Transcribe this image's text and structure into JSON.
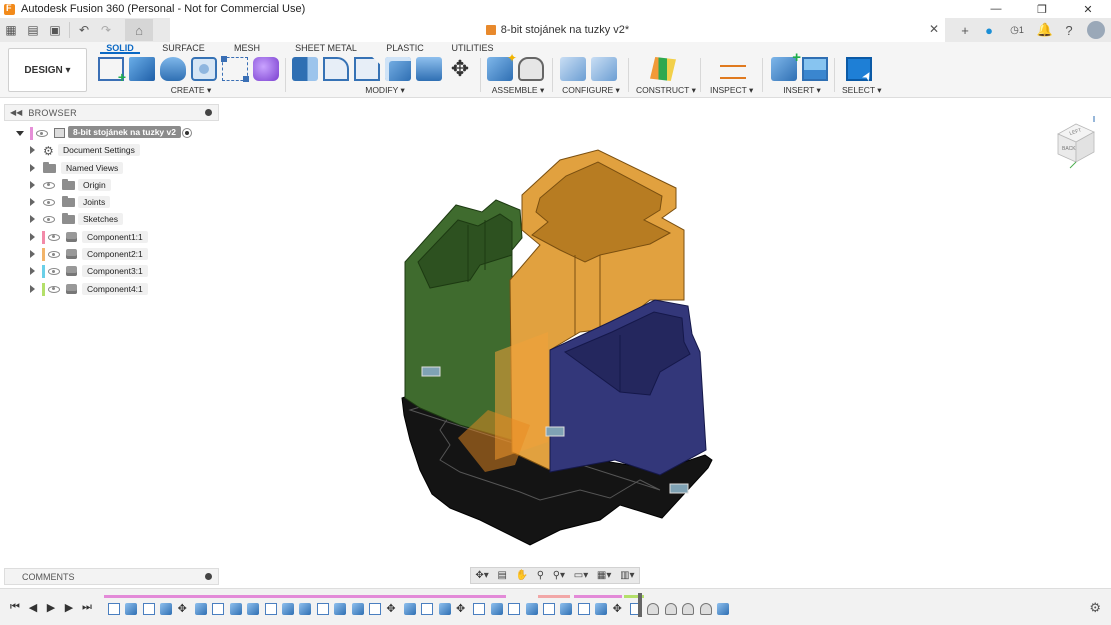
{
  "window": {
    "title": "Autodesk Fusion 360 (Personal - Not for Commercial Use)",
    "controls": [
      "—",
      "❐",
      "✕"
    ]
  },
  "qat": {
    "doc_tab_name": "8-bit stojánek na tuzky v2*",
    "close_glyph": "✕",
    "job_status_count": "1"
  },
  "ribbon": {
    "workspace": "DESIGN ▾",
    "tabs": [
      "SOLID",
      "SURFACE",
      "MESH",
      "SHEET METAL",
      "PLASTIC",
      "UTILITIES"
    ],
    "groups": {
      "create": "CREATE ▾",
      "modify": "MODIFY ▾",
      "assemble": "ASSEMBLE ▾",
      "configure": "CONFIGURE ▾",
      "construct": "CONSTRUCT ▾",
      "inspect": "INSPECT ▾",
      "insert": "INSERT ▾",
      "select": "SELECT ▾"
    }
  },
  "browser": {
    "title": "BROWSER",
    "root": "8-bit stojánek na tuzky v2",
    "items": [
      {
        "label": "Document Settings"
      },
      {
        "label": "Named Views"
      },
      {
        "label": "Origin"
      },
      {
        "label": "Joints"
      },
      {
        "label": "Sketches"
      },
      {
        "label": "Component1:1",
        "color": "#f28aa8"
      },
      {
        "label": "Component2:1",
        "color": "#f2b46a"
      },
      {
        "label": "Component3:1",
        "color": "#6ad0e8"
      },
      {
        "label": "Component4:1",
        "color": "#b4e06a"
      }
    ]
  },
  "comments": {
    "title": "COMMENTS"
  },
  "viewcube": {
    "top_face": "LEFT",
    "side_face": "BACK"
  },
  "colors": {
    "accent": "#0a68c4",
    "green": "#3f6b2e",
    "orange": "#e1a13f",
    "navy": "#33377a",
    "black": "#141414"
  }
}
